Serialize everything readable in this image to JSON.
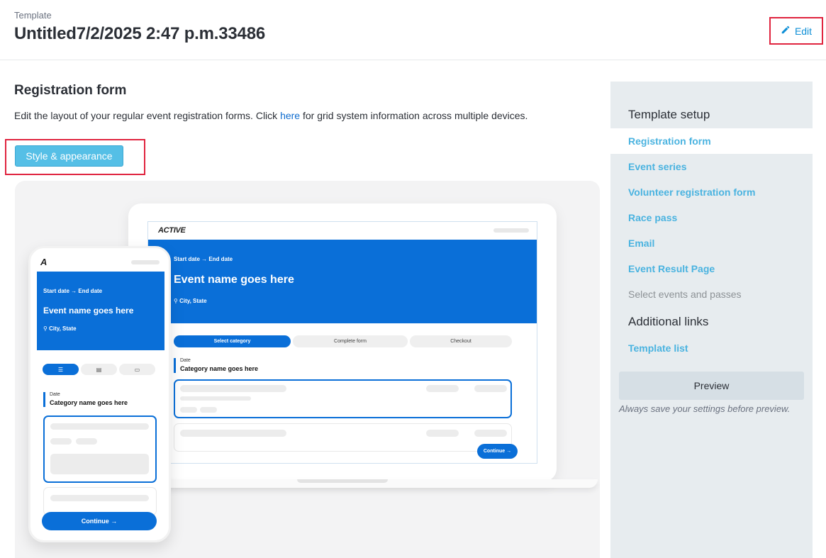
{
  "header": {
    "label": "Template",
    "title": "Untitled7/2/2025 2:47 p.m.33486",
    "edit_label": "Edit"
  },
  "main": {
    "title": "Registration form",
    "desc_before": "Edit the layout of your regular event registration forms. Click ",
    "desc_link": "here",
    "desc_after": " for grid system information across multiple devices.",
    "style_button": "Style & appearance"
  },
  "preview": {
    "logo": "ACTIVE",
    "dates": "Start date  →  End date",
    "event_name": "Event name goes here",
    "location": "City, State",
    "steps": [
      "Select category",
      "Complete form",
      "Checkout"
    ],
    "date_label": "Date",
    "category_name": "Category name goes here",
    "continue": "Continue →",
    "mobile_logo": "A"
  },
  "sidebar": {
    "setup_heading": "Template setup",
    "items": [
      {
        "label": "Registration form"
      },
      {
        "label": "Event series"
      },
      {
        "label": "Volunteer registration form"
      },
      {
        "label": "Race pass"
      },
      {
        "label": "Email"
      },
      {
        "label": "Event Result Page"
      },
      {
        "label": "Select events and passes"
      }
    ],
    "links_heading": "Additional links",
    "links": [
      {
        "label": "Template list"
      }
    ],
    "preview_button": "Preview",
    "preview_note": "Always save your settings before preview."
  },
  "colors": {
    "brand_blue": "#0a6fd8",
    "link_cyan": "#4ab3e0",
    "style_button": "#55bfe6",
    "highlight_red": "#e0243f"
  }
}
